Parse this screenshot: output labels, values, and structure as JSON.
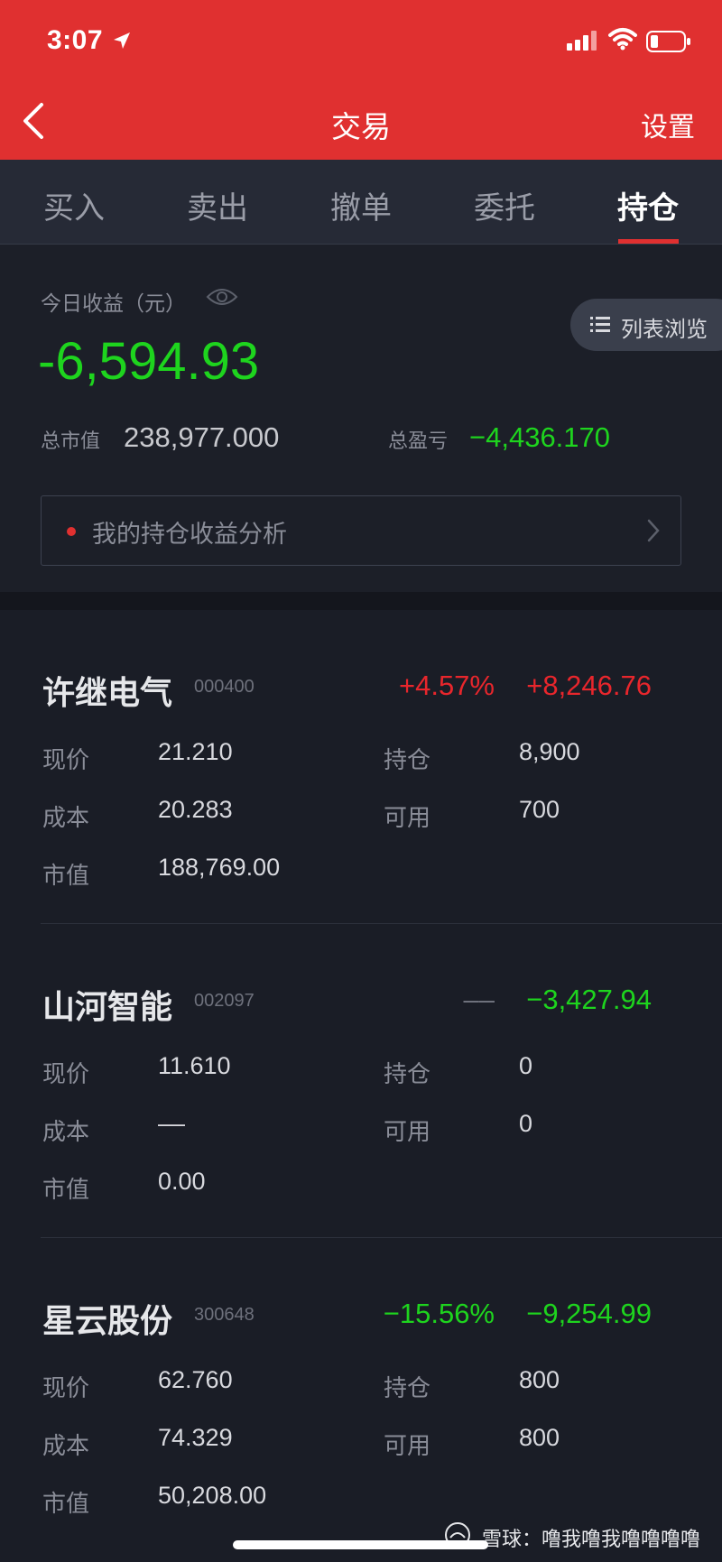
{
  "status_bar": {
    "time": "3:07"
  },
  "nav": {
    "title": "交易",
    "settings_label": "设置"
  },
  "tabs": [
    {
      "label": "买入",
      "active": false
    },
    {
      "label": "卖出",
      "active": false
    },
    {
      "label": "撤单",
      "active": false
    },
    {
      "label": "委托",
      "active": false
    },
    {
      "label": "持仓",
      "active": true
    }
  ],
  "summary": {
    "today_label": "今日收益（元）",
    "today_value": "-6,594.93",
    "list_view_label": "列表浏览",
    "market_value_label": "总市值",
    "market_value": "238,977.000",
    "total_pl_label": "总盈亏",
    "total_pl": "−4,436.170",
    "analysis_label": "我的持仓收益分析"
  },
  "field_labels": {
    "price": "现价",
    "cost": "成本",
    "market_value": "市值",
    "position": "持仓",
    "available": "可用"
  },
  "holdings": [
    {
      "name": "许继电气",
      "code": "000400",
      "pct": "+4.57%",
      "amount": "+8,246.76",
      "pct_color": "red",
      "amount_color": "red",
      "price": "21.210",
      "cost": "20.283",
      "market_value": "188,769.00",
      "position": "8,900",
      "available": "700"
    },
    {
      "name": "山河智能",
      "code": "002097",
      "pct": "––",
      "amount": "−3,427.94",
      "pct_color": "gray",
      "amount_color": "green",
      "price": "11.610",
      "cost": "––",
      "market_value": "0.00",
      "position": "0",
      "available": "0"
    },
    {
      "name": "星云股份",
      "code": "300648",
      "pct": "−15.56%",
      "amount": "−9,254.99",
      "pct_color": "green",
      "amount_color": "green",
      "price": "62.760",
      "cost": "74.329",
      "market_value": "50,208.00",
      "position": "800",
      "available": "800"
    }
  ],
  "watermark": "雪球：噜我噜我噜噜噜噜",
  "colors": {
    "header_red": "#e03030",
    "gain_red": "#e8262c",
    "loss_green": "#1ed41e",
    "background": "#1a1d26"
  }
}
